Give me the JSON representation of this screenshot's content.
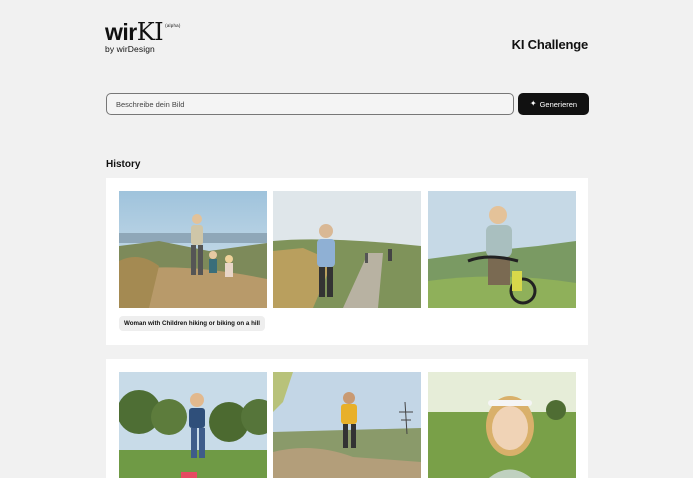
{
  "header": {
    "logo_main": "wir",
    "logo_ki": "KI",
    "logo_badge": "(alpha)",
    "logo_sub": "by wirDesign",
    "title": "KI Challenge"
  },
  "prompt": {
    "placeholder": "Beschreibe dein Bild",
    "button_label": "Generieren",
    "button_icon": "sparkle-icon"
  },
  "history": {
    "title": "History",
    "entries": [
      {
        "caption": "Woman with Children hiking or biking on a hill",
        "images": [
          "woman-with-children-hiking-photo",
          "woman-running-on-path-photo",
          "woman-riding-bike-photo"
        ]
      },
      {
        "images": [
          "child-running-in-park-photo",
          "man-running-on-trail-photo",
          "smiling-girl-with-headband-photo"
        ]
      }
    ]
  }
}
